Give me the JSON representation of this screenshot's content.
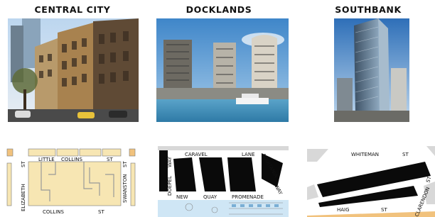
{
  "panels": [
    {
      "title": "CENTRAL CITY",
      "photo": "victorian-streetscape-photo",
      "map_labels": {
        "little": "LITTLE",
        "collins_top": "COLLINS",
        "st_top": "ST",
        "st_left": "ST",
        "elizabeth": "ELIZABETH",
        "swanston": "SWANSTON",
        "st_right": "ST",
        "collins_bottom": "COLLINS",
        "st_bottom": "ST"
      }
    },
    {
      "title": "DOCKLANDS",
      "photo": "waterfront-towers-photo",
      "map_labels": {
        "caravel": "CARAVEL",
        "lane": "LANE",
        "aquitania": "AQUITANIA",
        "way_right": "WAY",
        "way_left": "WAY",
        "doepel": "DOEPEL",
        "new": "NEW",
        "quay": "QUAY",
        "promenade": "PROMENADE"
      }
    },
    {
      "title": "SOUTHBANK",
      "photo": "glass-tower-photo",
      "map_labels": {
        "whiteman": "WHITEMAN",
        "st_top": "ST",
        "st_side": "ST",
        "haig": "HAIG",
        "st_bottom": "ST",
        "clarendon": "CLARENDON"
      }
    }
  ],
  "colors": {
    "block_cream": "#f7e6b3",
    "block_black": "#0a0a0a",
    "water_blue": "#cfe6f5",
    "plaza_orange": "#f1c27d",
    "grey_edge": "#d8d8d8"
  }
}
